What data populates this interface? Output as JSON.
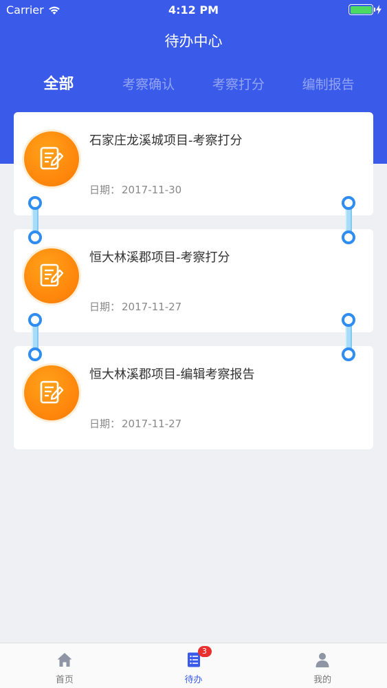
{
  "status_bar": {
    "carrier": "Carrier",
    "time": "4:12 PM",
    "battery_color": "#4cd964"
  },
  "header": {
    "title": "待办中心",
    "bg_color": "#3a5aea"
  },
  "tabs": [
    {
      "label": "全部",
      "active": true
    },
    {
      "label": "考察确认",
      "active": false
    },
    {
      "label": "考察打分",
      "active": false
    },
    {
      "label": "编制报告",
      "active": false
    }
  ],
  "tasks": [
    {
      "title": "石家庄龙溪城项目-考察打分",
      "date_label": "日期：",
      "date": "2017-11-30",
      "icon": "edit-document-icon"
    },
    {
      "title": "恒大林溪郡项目-考察打分",
      "date_label": "日期：",
      "date": "2017-11-27",
      "icon": "edit-document-icon"
    },
    {
      "title": "恒大林溪郡项目-编辑考察报告",
      "date_label": "日期：",
      "date": "2017-11-27",
      "icon": "edit-document-icon"
    }
  ],
  "tabbar": {
    "items": [
      {
        "label": "首页",
        "icon": "home-icon",
        "active": false
      },
      {
        "label": "待办",
        "icon": "todo-list-icon",
        "active": true,
        "badge": "3"
      },
      {
        "label": "我的",
        "icon": "user-icon",
        "active": false
      }
    ],
    "accent_color": "#3a5aea",
    "badge_color": "#e8312f"
  }
}
